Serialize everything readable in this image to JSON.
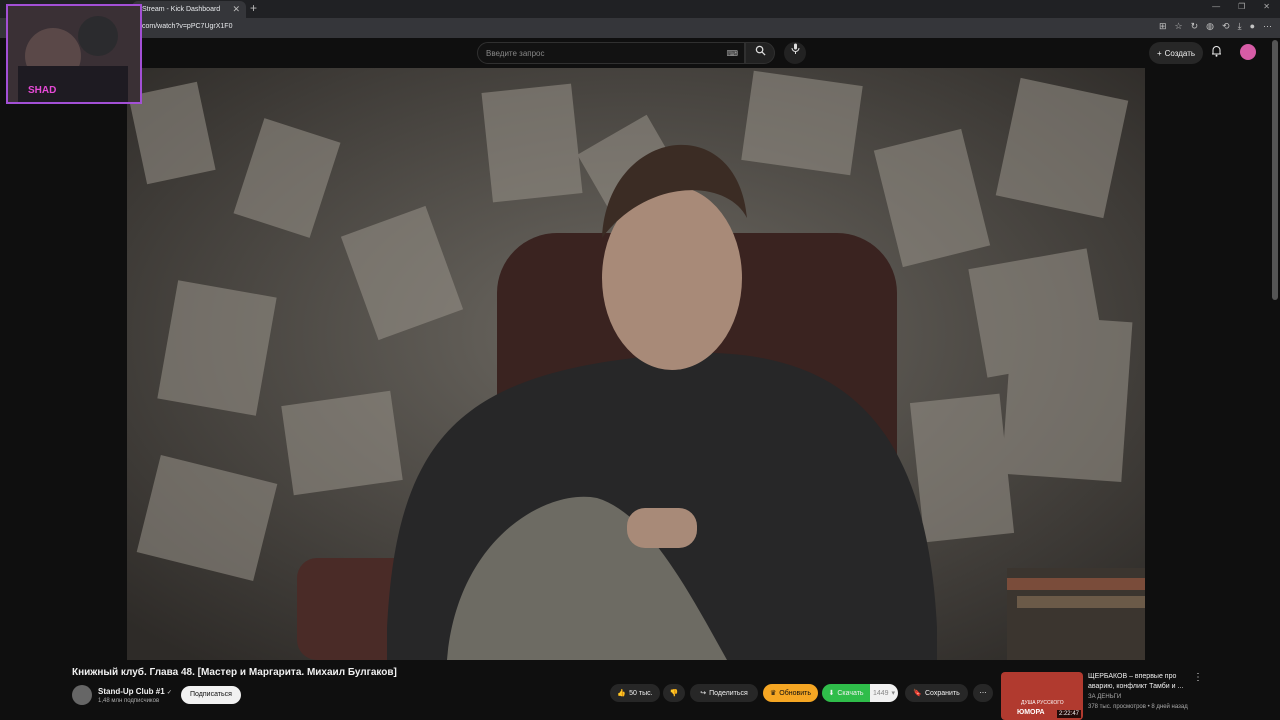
{
  "browser": {
    "tab_title": "Stream - Kick Dashboard",
    "url": "com/watch?v=pPC7UgrX1F0"
  },
  "header": {
    "search_placeholder": "Введите запрос",
    "create_label": "Создать"
  },
  "overlay": {
    "stream_tag": "SHAD"
  },
  "video": {
    "title": "Книжный клуб. Глава 48. [Мастер и Маргарита. Михаил Булгаков]",
    "channel": "Stand-Up Club #1",
    "subscribers": "1,48 млн подписчиков",
    "subscribe_label": "Подписаться"
  },
  "actions": {
    "likes": "50 тыс.",
    "share": "Поделиться",
    "update": "Обновить",
    "download": "Скачать",
    "download_count": "1449",
    "save": "Сохранить"
  },
  "recommendation": {
    "title": "ЩЕРБАКОВ – впервые про аварию, конфликт Тамби и ...",
    "channel": "ЗА ДЕНЬГИ",
    "meta": "378 тыс. просмотров • 8 дней назад",
    "duration": "2:22:47",
    "thumb_text": "ЮМОРА",
    "thumb_text_top": "ДУША РУССКОГО"
  },
  "colors": {
    "accent_update": "#f5a623",
    "accent_download": "#2fbd4a",
    "pip_border": "#a350d6"
  }
}
